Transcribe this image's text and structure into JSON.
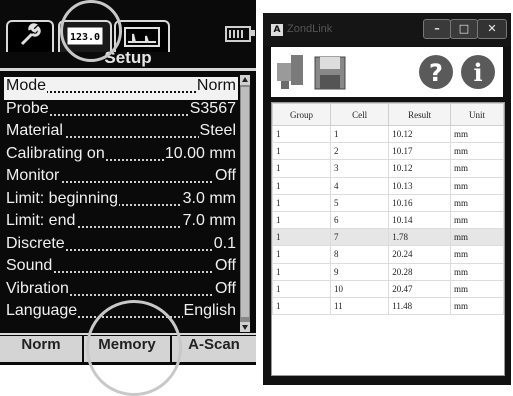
{
  "device": {
    "title": "Setup",
    "tab_icons": [
      "wrench-icon",
      "display-123-icon",
      "waveform-icon"
    ],
    "tab2_text": "123.0",
    "battery_icon": "battery-icon",
    "menu": [
      {
        "label": "Mode",
        "value": "Norm",
        "selected": true
      },
      {
        "label": "Probe",
        "value": "S3567"
      },
      {
        "label": "Material",
        "value": "Steel"
      },
      {
        "label": "Calibrating on",
        "value": "10.00 mm"
      },
      {
        "label": "Monitor",
        "value": "Off"
      },
      {
        "label": "Limit: beginning",
        "value": "3.0 mm"
      },
      {
        "label": "Limit: end",
        "value": "7.0 mm"
      },
      {
        "label": "Discrete",
        "value": "0.1"
      },
      {
        "label": "Sound",
        "value": "Off"
      },
      {
        "label": "Vibration",
        "value": "Off"
      },
      {
        "label": "Language",
        "value": "English"
      }
    ],
    "softkeys": [
      "Norm",
      "Memory",
      "A-Scan"
    ]
  },
  "window": {
    "title": "ZondLink",
    "app_icon_text": "A",
    "buttons": {
      "minimize": "–",
      "maximize": "□",
      "close": "✕"
    },
    "toolbar_icons": [
      "device-icon",
      "save-icon",
      "help-icon",
      "info-icon"
    ],
    "columns": [
      "Group",
      "Cell",
      "Result",
      "Unit"
    ],
    "rows": [
      [
        "1",
        "1",
        "10.12",
        "mm"
      ],
      [
        "1",
        "2",
        "10.17",
        "mm"
      ],
      [
        "1",
        "3",
        "10.12",
        "mm"
      ],
      [
        "1",
        "4",
        "10.13",
        "mm"
      ],
      [
        "1",
        "5",
        "10.16",
        "mm"
      ],
      [
        "1",
        "6",
        "10.14",
        "mm"
      ],
      [
        "1",
        "7",
        "1.78",
        "mm"
      ],
      [
        "1",
        "8",
        "20.24",
        "mm"
      ],
      [
        "1",
        "9",
        "20.28",
        "mm"
      ],
      [
        "1",
        "10",
        "20.47",
        "mm"
      ],
      [
        "1",
        "11",
        "11.48",
        "mm"
      ]
    ],
    "highlighted_row": 7
  }
}
